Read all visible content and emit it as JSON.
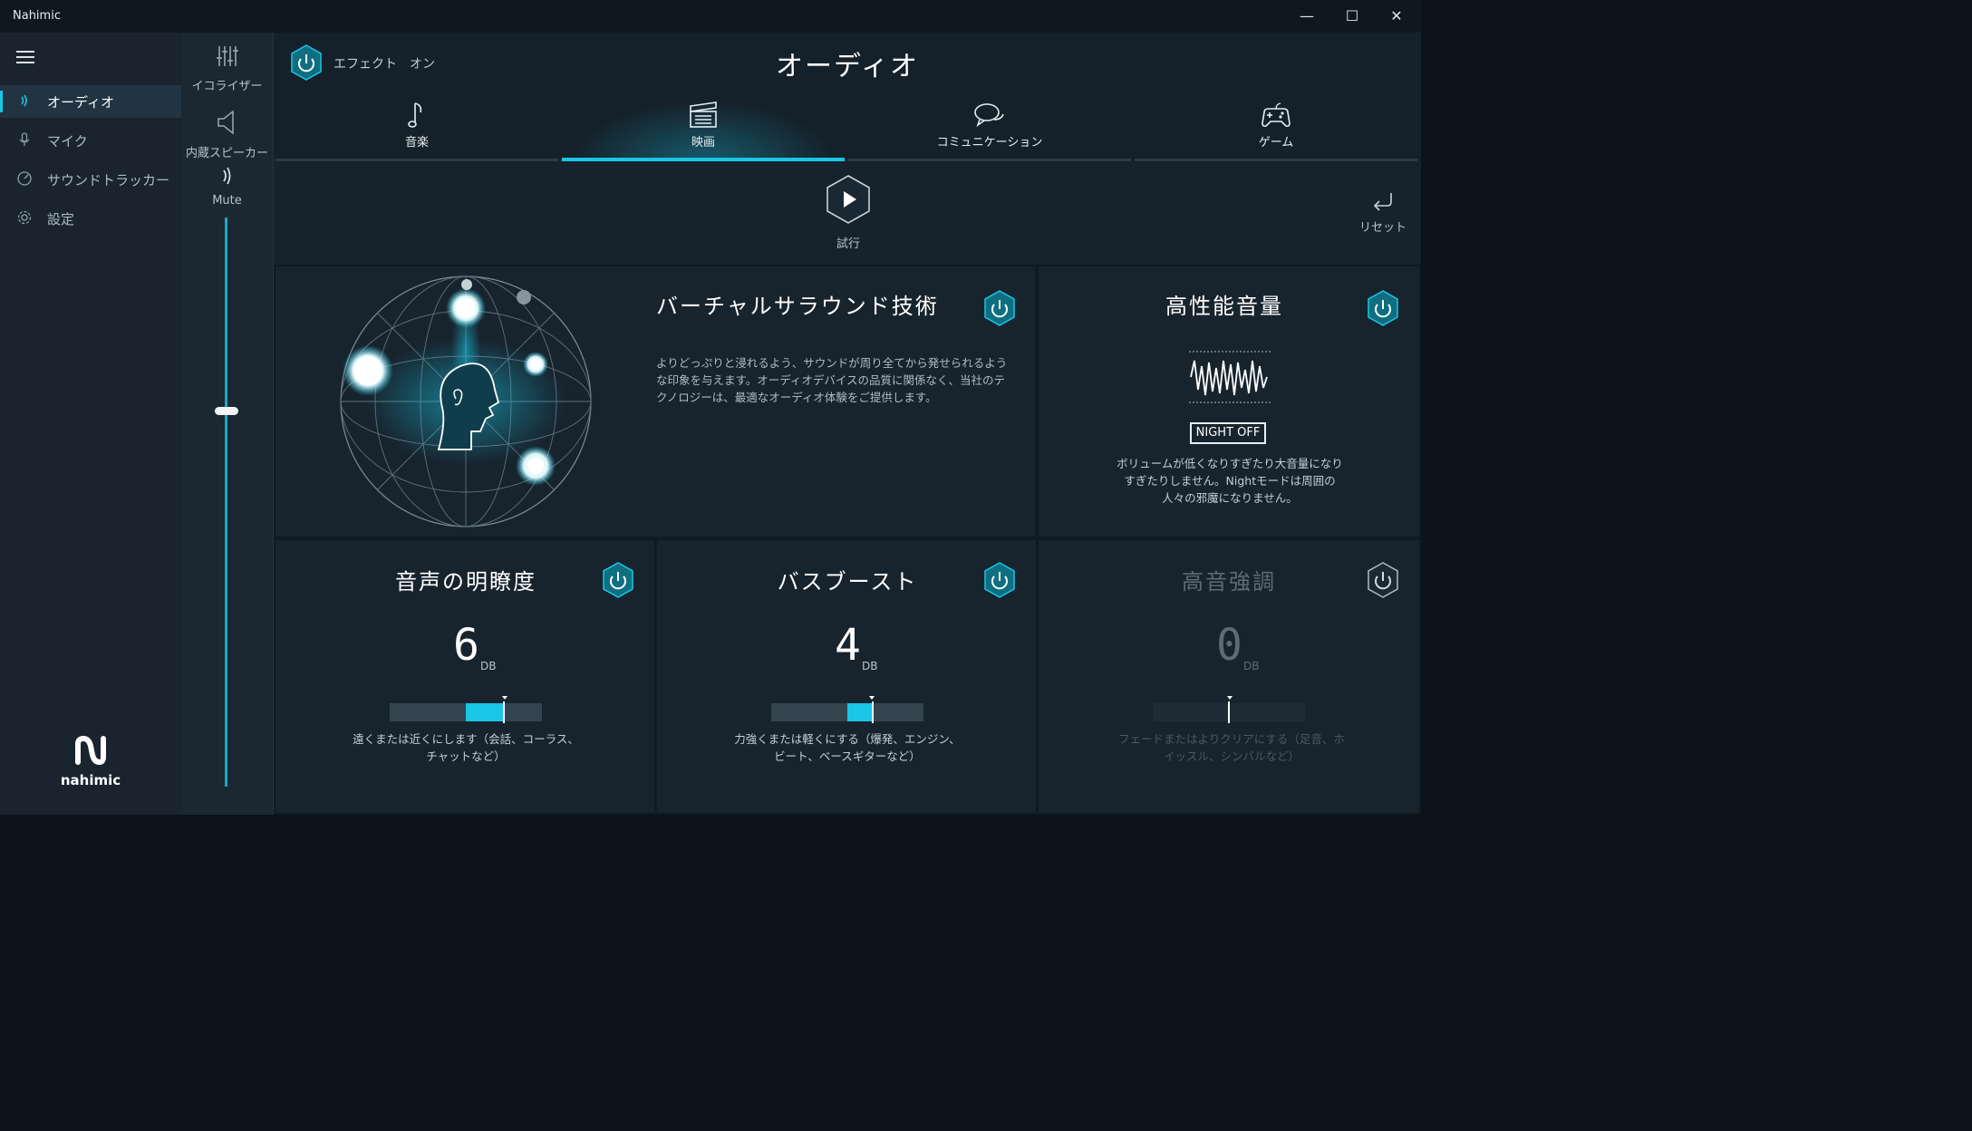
{
  "window": {
    "title": "Nahimic",
    "minimize_glyph": "—",
    "maximize_glyph": "☐",
    "close_glyph": "✕"
  },
  "sidebar": {
    "items": [
      {
        "label": "オーディオ",
        "icon": "sound-wave-icon"
      },
      {
        "label": "マイク",
        "icon": "microphone-icon"
      },
      {
        "label": "サウンドトラッカー",
        "icon": "compass-icon"
      },
      {
        "label": "設定",
        "icon": "gear-icon"
      }
    ],
    "logo": {
      "text": "nahimic"
    }
  },
  "devices": {
    "equalizer": "イコライザー",
    "speaker": "内蔵スピーカー",
    "mute": "Mute",
    "volume_level": 0.66
  },
  "header": {
    "effect_label": "エフェクト　オン",
    "title": "オーディオ"
  },
  "tabs": [
    {
      "label": "音楽",
      "icon": "music-note-icon"
    },
    {
      "label": "映画",
      "icon": "clapperboard-icon"
    },
    {
      "label": "コミュニケーション",
      "icon": "chat-bubbles-icon"
    },
    {
      "label": "ゲーム",
      "icon": "gamepad-icon"
    }
  ],
  "active_tab": "映画",
  "try_label": "試行",
  "reset_label": "リセット",
  "panels": {
    "surround": {
      "title": "バーチャルサラウンド技術",
      "description": "よりどっぷりと浸れるよう、サウンドが周り全てから発せられるような印象を与えます。オーディオデバイスの品質に関係なく、当社のテクノロジーは、最適なオーディオ体験をご提供します。"
    },
    "volume": {
      "title": "高性能音量",
      "button": "NIGHT OFF",
      "description": "ボリュームが低くなりすぎたり大音量になりすぎたりしません。Nightモードは周囲の人々の邪魔になりません。"
    },
    "voice": {
      "title": "音声の明瞭度",
      "value": "6",
      "unit": "DB",
      "level": 6,
      "description": "遠くまたは近くにします（会話、コーラス、チャットなど）"
    },
    "bass": {
      "title": "バスブースト",
      "value": "4",
      "unit": "DB",
      "level": 4,
      "description": "力強くまたは軽くにする（爆発、エンジン、ビート、ベースギターなど）"
    },
    "treble": {
      "title": "高音強調",
      "value": "0",
      "unit": "DB",
      "level": 0,
      "description": "フェードまたはよりクリアにする（足音、ホイッスル、シンバルなど）"
    }
  },
  "colors": {
    "accent": "#19c6e6",
    "background": "#16222c",
    "sidebar": "#19242e",
    "panel": "#17242e"
  }
}
